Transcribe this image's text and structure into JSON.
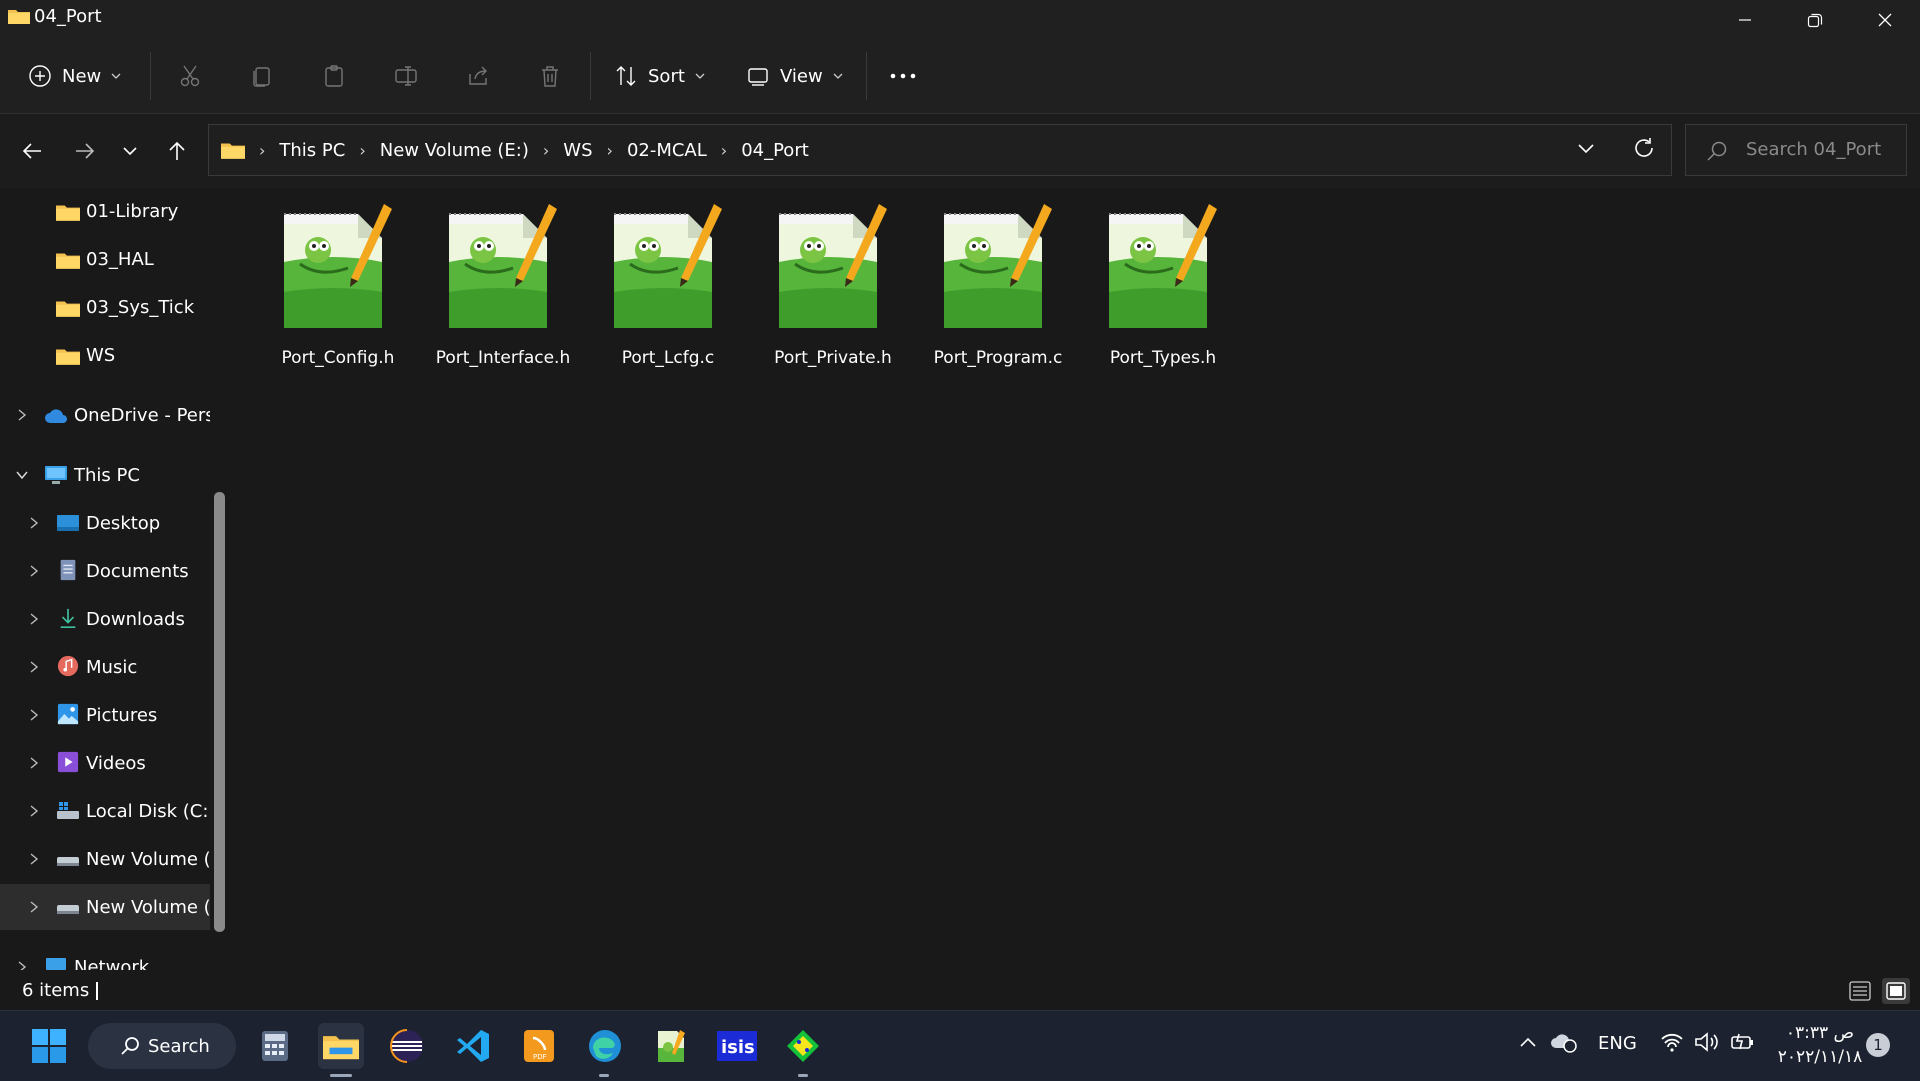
{
  "window": {
    "title": "04_Port"
  },
  "toolbar": {
    "new_label": "New",
    "sort_label": "Sort",
    "view_label": "View",
    "disabled_actions": [
      "cut-icon",
      "copy-icon",
      "paste-icon",
      "rename-icon",
      "share-icon",
      "delete-icon"
    ]
  },
  "address": {
    "crumbs": [
      "This PC",
      "New Volume (E:)",
      "WS",
      "02-MCAL",
      "04_Port"
    ]
  },
  "search": {
    "placeholder": "Search 04_Port"
  },
  "sidebar": {
    "items": [
      {
        "label": "01-Library",
        "icon": "folder-icon"
      },
      {
        "label": "03_HAL",
        "icon": "folder-icon"
      },
      {
        "label": "03_Sys_Tick",
        "icon": "folder-icon"
      },
      {
        "label": "WS",
        "icon": "folder-icon"
      },
      {
        "label": "OneDrive - Perso",
        "icon": "onedrive-icon"
      },
      {
        "label": "This PC",
        "icon": "pc-icon"
      },
      {
        "label": "Desktop",
        "icon": "desktop-icon"
      },
      {
        "label": "Documents",
        "icon": "documents-icon"
      },
      {
        "label": "Downloads",
        "icon": "downloads-icon"
      },
      {
        "label": "Music",
        "icon": "music-icon"
      },
      {
        "label": "Pictures",
        "icon": "pictures-icon"
      },
      {
        "label": "Videos",
        "icon": "videos-icon"
      },
      {
        "label": "Local Disk (C:)",
        "icon": "local-disk-icon"
      },
      {
        "label": "New Volume (D",
        "icon": "drive-icon"
      },
      {
        "label": "New Volume (E:",
        "icon": "drive-icon"
      },
      {
        "label": "Network",
        "icon": "network-icon"
      }
    ]
  },
  "files": [
    {
      "name": "Port_Config.h",
      "icon": "notepadpp-file-icon"
    },
    {
      "name": "Port_Interface.h",
      "icon": "notepadpp-file-icon"
    },
    {
      "name": "Port_Lcfg.c",
      "icon": "notepadpp-file-icon"
    },
    {
      "name": "Port_Private.h",
      "icon": "notepadpp-file-icon"
    },
    {
      "name": "Port_Program.c",
      "icon": "notepadpp-file-icon"
    },
    {
      "name": "Port_Types.h",
      "icon": "notepadpp-file-icon"
    }
  ],
  "status": {
    "item_count": "6 items"
  },
  "taskbar": {
    "search_label": "Search",
    "lang": "ENG",
    "time": "ص ٠٣:٣٣",
    "date": "٢٠٢٢/١١/١٨",
    "notification_count": "1"
  },
  "colors": {
    "folder": "#f2c14e",
    "accent": "#4cc2ff",
    "window_bg": "#191919"
  }
}
